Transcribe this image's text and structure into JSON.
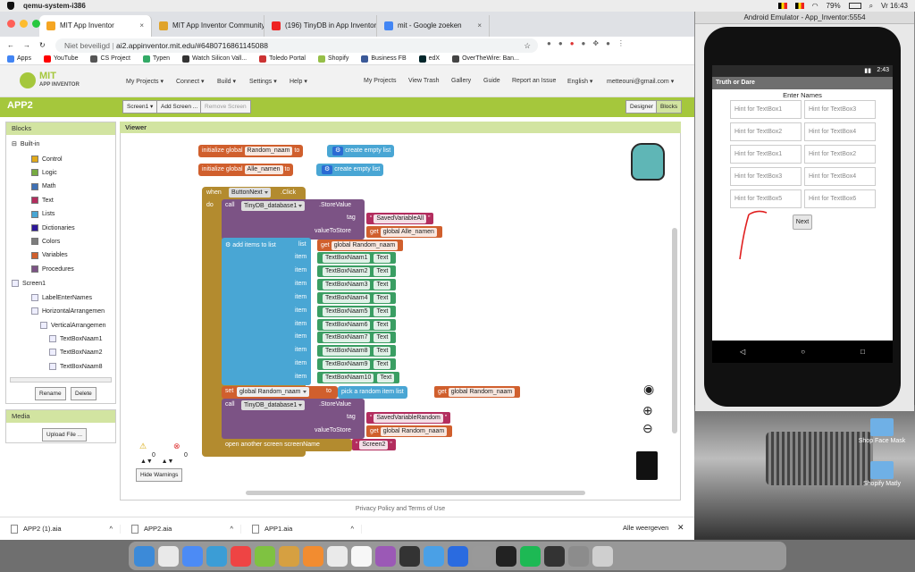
{
  "menubar": {
    "app": "qemu-system-i386",
    "battery": "79%",
    "clock": "Vr 16:43"
  },
  "browser": {
    "tabs": [
      {
        "label": "MIT App Inventor",
        "color": "#f5a623",
        "active": true
      },
      {
        "label": "MIT App Inventor Community",
        "color": "#e0a32a",
        "active": false
      },
      {
        "label": "(196) TinyDB in App Inventor",
        "color": "#e22",
        "active": false
      },
      {
        "label": "mit - Google zoeken",
        "color": "#4285f4",
        "active": false
      }
    ],
    "address_security": "Niet beveiligd",
    "address": "ai2.appinventor.mit.edu/#6480716861145088",
    "bookmarks": [
      "Apps",
      "YouTube",
      "CS Project",
      "Typen",
      "Watch Silicon Vall...",
      "Toledo Portal",
      "Shopify",
      "Business FB",
      "edX",
      "OverTheWire: Ban..."
    ]
  },
  "ai": {
    "logo_line1": "MIT",
    "logo_line2": "APP INVENTOR",
    "nav": [
      "My Projects ▾",
      "Connect ▾",
      "Build ▾",
      "Settings ▾",
      "Help ▾"
    ],
    "nav_right": [
      "My Projects",
      "View Trash",
      "Gallery",
      "Guide",
      "Report an Issue",
      "English ▾",
      "metteouni@gmail.com ▾"
    ],
    "project": "APP2",
    "screen_btn": "Screen1 ▾",
    "add_screen": "Add Screen ...",
    "remove_screen": "Remove Screen",
    "designer": "Designer",
    "blocks": "Blocks"
  },
  "blocks_panel": {
    "title": "Blocks",
    "builtin": "Built-in",
    "categories": [
      {
        "name": "Control",
        "color": "#e1a91a"
      },
      {
        "name": "Logic",
        "color": "#77ab41"
      },
      {
        "name": "Math",
        "color": "#3f71b5"
      },
      {
        "name": "Text",
        "color": "#b32d5e"
      },
      {
        "name": "Lists",
        "color": "#49a6d4"
      },
      {
        "name": "Dictionaries",
        "color": "#2d1799"
      },
      {
        "name": "Colors",
        "color": "#7d7d7d"
      },
      {
        "name": "Variables",
        "color": "#d05f2d"
      },
      {
        "name": "Procedures",
        "color": "#7c5385"
      }
    ],
    "components": [
      "Screen1",
      "LabelEnterNames",
      "HorizontalArrangemen",
      "VerticalArrangemen",
      "TextBoxNaam1",
      "TextBoxNaam2",
      "TextBoxNaam8"
    ],
    "rename": "Rename",
    "delete": "Delete",
    "media_title": "Media",
    "upload": "Upload File ..."
  },
  "viewer": {
    "title": "Viewer",
    "init1": {
      "kw": "initialize global",
      "name": "Random_naam",
      "to": "to",
      "val": "create empty list"
    },
    "init2": {
      "kw": "initialize global",
      "name": "Alle_namen",
      "to": "to",
      "val": "create empty list"
    },
    "when": "when",
    "button": "ButtonNext",
    "click": ".Click",
    "do": "do",
    "call1": {
      "call": "call",
      "db": "TinyDB_database1",
      "method": ".StoreValue",
      "tag": "tag",
      "tagval": "SavedVariableAll",
      "vts": "valueToStore",
      "get": "get",
      "getvar": "global Alle_namen"
    },
    "additems": {
      "label": "add items to list",
      "list": "list",
      "get": "get",
      "getvar": "global Random_naam",
      "item": "item"
    },
    "items": [
      "TextBoxNaam1",
      "TextBoxNaam2",
      "TextBoxNaam3",
      "TextBoxNaam4",
      "TextBoxNaam5",
      "TextBoxNaam6",
      "TextBoxNaam7",
      "TextBoxNaam8",
      "TextBoxNaam9",
      "TextBoxNaam10"
    ],
    "text_prop": "Text",
    "set": {
      "set": "set",
      "var": "global Random_naam",
      "to": "to",
      "pick": "pick a random item  list",
      "get": "get",
      "getvar": "global Random_naam"
    },
    "call2": {
      "call": "call",
      "db": "TinyDB_database1",
      "method": ".StoreValue",
      "tag": "tag",
      "tagval": "SavedVariableRandom",
      "vts": "valueToStore",
      "get": "get",
      "getvar": "global Random_naam"
    },
    "open": {
      "label": "open another screen  screenName",
      "val": "Screen2"
    },
    "warn_count": "0",
    "err_count": "0",
    "hide_warnings": "Hide Warnings"
  },
  "footer": "Privacy Policy and Terms of Use",
  "downloads": [
    "APP2 (1).aia",
    "APP2.aia",
    "APP1.aia"
  ],
  "downloads_all": "Alle weergeven",
  "emulator": {
    "title": "Android Emulator - App_Inventor:5554",
    "time": "2:43",
    "app_title": "Truth or Dare",
    "heading": "Enter Names",
    "boxes": [
      [
        "Hint for TextBox1",
        "Hint for TextBox3"
      ],
      [
        "Hint for TextBox2",
        "Hint for TextBox4"
      ],
      [
        "Hint for TextBox1",
        "Hint for TextBox2"
      ],
      [
        "Hint for TextBox3",
        "Hint for TextBox4"
      ],
      [
        "Hint for TextBox5",
        "Hint for TextBox6"
      ]
    ],
    "next": "Next"
  },
  "desktop": {
    "icons": [
      "Shop Face Mask",
      "Shopify Matly"
    ]
  }
}
